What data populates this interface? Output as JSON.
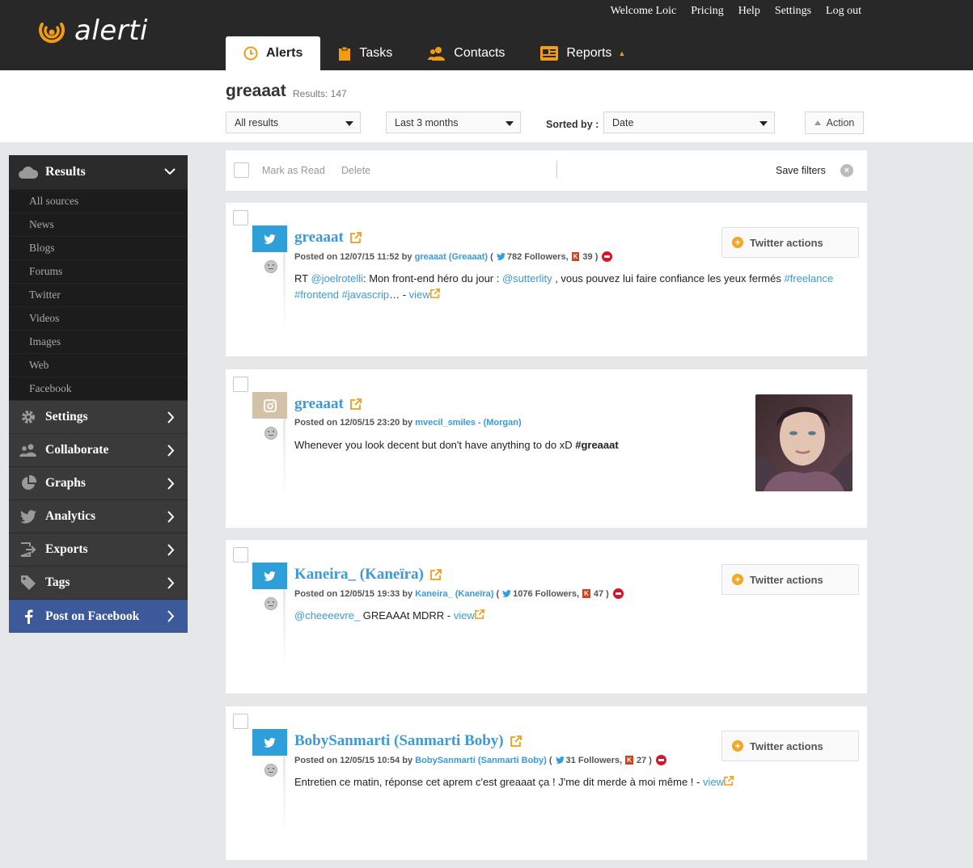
{
  "brand": {
    "name": "alerti",
    "accent": "#f39c12"
  },
  "toplinks": [
    "Welcome Loic",
    "Pricing",
    "Help",
    "Settings",
    "Log out"
  ],
  "nav": {
    "alerts": "Alerts",
    "tasks": "Tasks",
    "contacts": "Contacts",
    "reports": "Reports"
  },
  "header": {
    "query": "greaaat",
    "results": "Results: 147",
    "filter_scope": "All results",
    "filter_period": "Last 3 months",
    "sorted_by_label": "Sorted by :",
    "sort_value": "Date",
    "action": "Action"
  },
  "sidebar": {
    "results": "Results",
    "sources": [
      "All sources",
      "News",
      "Blogs",
      "Forums",
      "Twitter",
      "Videos",
      "Images",
      "Web",
      "Facebook"
    ],
    "settings": "Settings",
    "collaborate": "Collaborate",
    "graphs": "Graphs",
    "analytics": "Analytics",
    "exports": "Exports",
    "tags": "Tags",
    "post_facebook": "Post on Facebook"
  },
  "bulk": {
    "mark_read": "Mark as Read",
    "delete": "Delete",
    "save_filters": "Save filters"
  },
  "twitter_actions": "Twitter actions",
  "cards": [
    {
      "source": "twitter",
      "author": "greaaat",
      "posted": "Posted on 12/07/15 11:52 by",
      "by": "greaaat (Greaaat)",
      "paren_open": "(",
      "followers": "782 Followers,",
      "klout": "39 )",
      "text_parts": [
        "RT ",
        "@joelrotelli",
        ": Mon front-end héro du jour : ",
        "@sutterlity",
        " , vous pouvez lui faire confiance les yeux fermés ",
        "#freelance",
        " ",
        "#frontend",
        " ",
        "#javascrip",
        "… - ",
        "view"
      ]
    },
    {
      "source": "instagram",
      "author": "greaaat",
      "posted": "Posted on 12/05/15 23:20 by",
      "by": "mvecil_smiles - (Morgan)",
      "text": "Whenever you look decent but don't have anything to do xD ",
      "hashtag": "#greaaat"
    },
    {
      "source": "twitter",
      "author": "Kaneira_ (Kaneïra)",
      "posted": "Posted on 12/05/15 19:33 by",
      "by": "Kaneira_ (Kaneïra)",
      "paren_open": "(",
      "followers": "1076 Followers,",
      "klout": "47 )",
      "mention": "@cheeeevre_",
      "text": " GREAAAt MDRR - ",
      "view": "view"
    },
    {
      "source": "twitter",
      "author": "BobySanmarti (Sanmarti Boby)",
      "posted": "Posted on 12/05/15 10:54 by",
      "by": "BobySanmarti (Sanmarti Boby)",
      "paren_open": "(",
      "followers": "31 Followers,",
      "klout": "27 )",
      "text": "Entretien ce matin, réponse cet aprem c'est greaaat ça ! J'me dit merde à moi même ! - ",
      "view": "view"
    }
  ]
}
